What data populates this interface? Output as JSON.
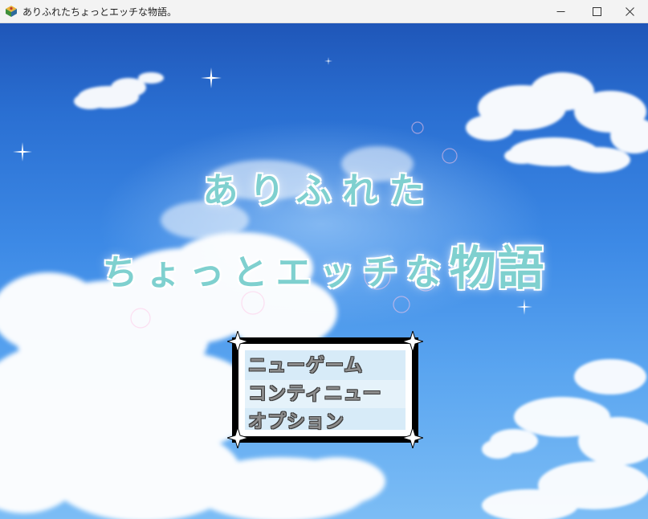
{
  "window": {
    "title": "ありふれたちょっとエッチな物語。",
    "icon": "game-app-icon",
    "controls": [
      "minimize-icon",
      "maximize-icon",
      "close-icon"
    ]
  },
  "logo": {
    "line1": "ありふれた",
    "line2_main": "ちょっとエッチな",
    "line2_big": "物語"
  },
  "menu": {
    "items": [
      {
        "label": "ニューゲーム"
      },
      {
        "label": "コンティニュー"
      },
      {
        "label": "オプション"
      }
    ],
    "selected_index": 1
  },
  "colors": {
    "logo_text": "#7fd0cf",
    "menu_bg": "#d7ebf8",
    "menu_text": "#8e8e8e",
    "sky_top": "#1f56b8",
    "sky_bottom": "#7cbdf5"
  }
}
